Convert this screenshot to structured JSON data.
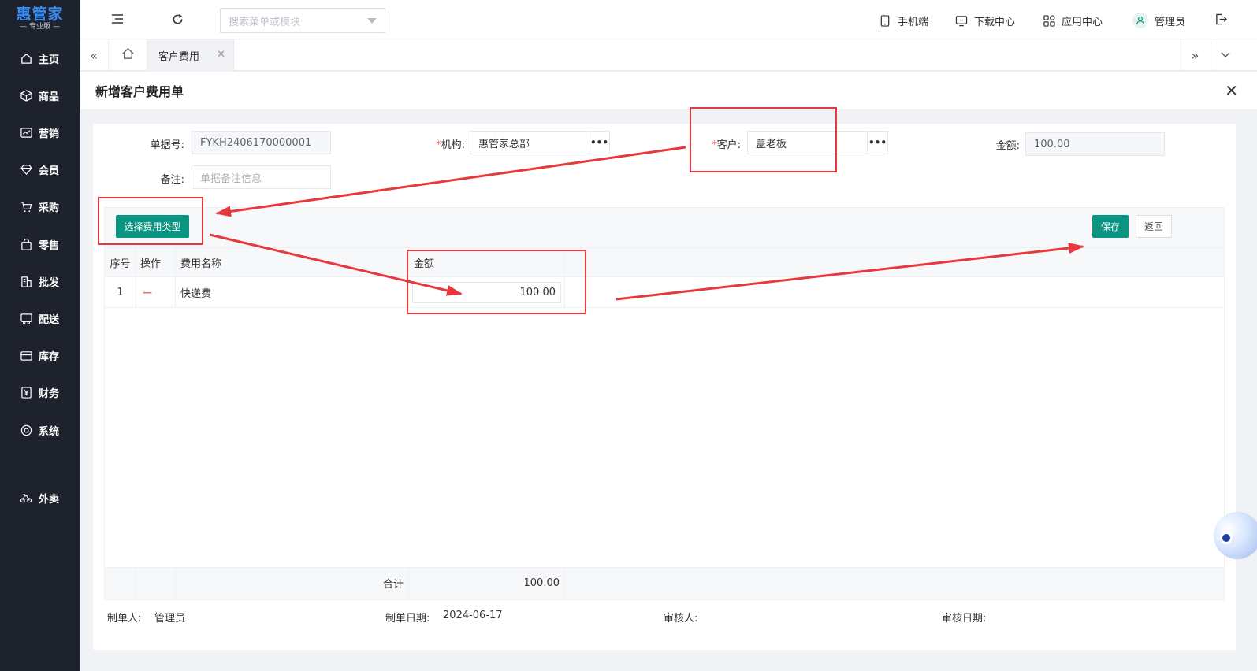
{
  "app": {
    "brand": "惠管家",
    "edition": "专业版"
  },
  "sidebar": {
    "items": [
      {
        "label": "主页",
        "icon": "home-icon"
      },
      {
        "label": "商品",
        "icon": "box-icon"
      },
      {
        "label": "营销",
        "icon": "trend-icon"
      },
      {
        "label": "会员",
        "icon": "diamond-icon"
      },
      {
        "label": "采购",
        "icon": "cart-icon"
      },
      {
        "label": "零售",
        "icon": "bag-icon"
      },
      {
        "label": "批发",
        "icon": "building-icon"
      },
      {
        "label": "配送",
        "icon": "truck-icon"
      },
      {
        "label": "库存",
        "icon": "storage-icon"
      },
      {
        "label": "财务",
        "icon": "yen-icon"
      },
      {
        "label": "系统",
        "icon": "settings-icon"
      },
      {
        "label": "外卖",
        "icon": "bike-icon"
      }
    ]
  },
  "topbar": {
    "search_placeholder": "搜索菜单或模块",
    "links": {
      "mobile": "手机端",
      "download": "下载中心",
      "apps": "应用中心",
      "user": "管理员"
    }
  },
  "tabs": {
    "active": "客户费用"
  },
  "form": {
    "title": "新增客户费用单",
    "doc_no_label": "单据号:",
    "doc_no_value": "FYKH2406170000001",
    "org_label": "机构:",
    "org_value": "惠管家总部",
    "customer_label": "客户:",
    "customer_value": "盖老板",
    "amount_label": "金额:",
    "amount_value": "100.00",
    "remark_label": "备注:",
    "remark_placeholder": "单据备注信息",
    "required_mark": "*"
  },
  "toolbar": {
    "select_type_label": "选择费用类型",
    "save_label": "保存",
    "back_label": "返回"
  },
  "grid": {
    "headers": {
      "seq": "序号",
      "op": "操作",
      "name": "费用名称",
      "amount": "金额"
    },
    "rows": [
      {
        "seq": "1",
        "op": "—",
        "name": "快递费",
        "amount": "100.00"
      }
    ],
    "total_label": "合计",
    "total_value": "100.00"
  },
  "footer": {
    "creator_label": "制单人:",
    "creator_value": "管理员",
    "date_label": "制单日期:",
    "date_value": "2024-06-17",
    "reviewer_label": "审核人:",
    "review_date_label": "审核日期:"
  },
  "colors": {
    "accent": "#0a9582",
    "annotation": "#e8383d",
    "sidebar": "#1e222d"
  }
}
